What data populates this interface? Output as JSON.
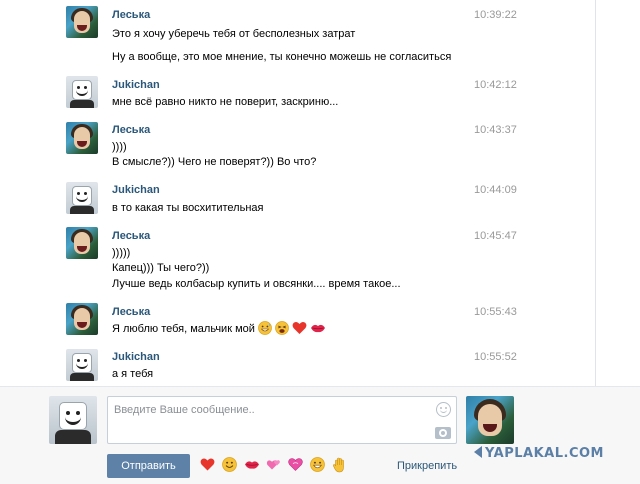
{
  "messages": [
    {
      "author": "Леська",
      "time": "10:39:22",
      "lines": [
        "Это я хочу уберечь тебя от бесполезных затрат",
        "",
        "Ну а вообще, это мое мнение, ты конечно можешь не согласиться"
      ]
    },
    {
      "author": "Jukichan",
      "time": "10:42:12",
      "lines": [
        "мне всё равно никто не поверит, заскриню..."
      ]
    },
    {
      "author": "Леська",
      "time": "10:43:37",
      "lines": [
        "))))",
        "В смысле?)) Чего не поверят?)) Во что?"
      ]
    },
    {
      "author": "Jukichan",
      "time": "10:44:09",
      "lines": [
        "в то какая ты восхитительная"
      ]
    },
    {
      "author": "Леська",
      "time": "10:45:47",
      "lines": [
        ")))))",
        "Капец))) Ты чего?))",
        "Лучше ведь колбасыр купить и овсянки.... время такое..."
      ]
    },
    {
      "author": "Леська",
      "time": "10:55:43",
      "lines": [
        "Я люблю тебя, мальчик мой"
      ],
      "emoji": [
        "sweat-smile-emoji",
        "tired-face-emoji",
        "red-heart-emoji",
        "kiss-lips-emoji"
      ]
    },
    {
      "author": "Jukichan",
      "time": "10:55:52",
      "lines": [
        "а я тебя"
      ]
    }
  ],
  "composer": {
    "placeholder": "Введите Ваше сообщение..",
    "send_label": "Отправить",
    "attach_label": "Прикрепить",
    "quick_emoji": [
      "red-heart-icon",
      "smile-icon",
      "kiss-lips-icon",
      "pink-hearts-icon",
      "heart-eyes-icon",
      "grin-icon",
      "raised-hand-icon"
    ]
  },
  "watermark": "YAPLAKAL.COM",
  "colors": {
    "author_name": "#2b587a",
    "timestamp": "#999999",
    "send_button": "#5e81a8",
    "link": "#2b587a"
  }
}
